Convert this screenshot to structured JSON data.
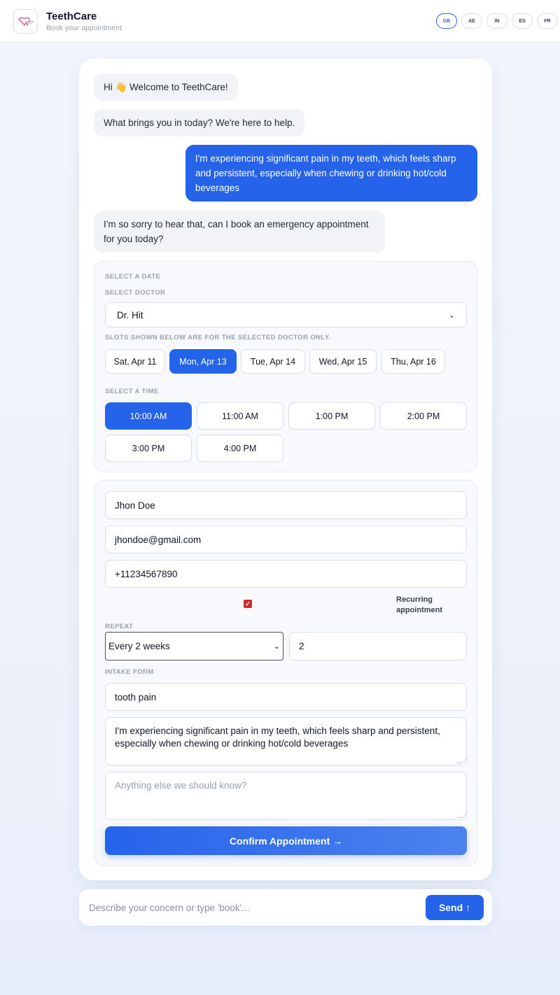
{
  "header": {
    "title": "TeethCare",
    "subtitle": "Book your appointment",
    "languages": [
      "GB",
      "AE",
      "IN",
      "ES",
      "FR"
    ],
    "active_language": "GB"
  },
  "chat": {
    "messages": [
      {
        "role": "bot",
        "text": "Hi 👋 Welcome to TeethCare!"
      },
      {
        "role": "bot",
        "text": "What brings you in today? We're here to help."
      },
      {
        "role": "user",
        "text": "I'm experiencing significant pain in my teeth, which feels sharp and persistent, especially when chewing or drinking hot/cold beverages"
      },
      {
        "role": "bot",
        "text": "I'm so sorry to hear that, can I book an emergency appointment for you today?"
      }
    ]
  },
  "scheduler": {
    "date_label": "SELECT A DATE",
    "doctor_label": "SELECT DOCTOR",
    "doctor_value": "Dr. Hit",
    "slots_note": "SLOTS SHOWN BELOW ARE FOR THE SELECTED DOCTOR ONLY.",
    "dates": [
      "Sat, Apr 11",
      "Mon, Apr 13",
      "Tue, Apr 14",
      "Wed, Apr 15",
      "Thu, Apr 16"
    ],
    "selected_date": "Mon, Apr 13",
    "time_label": "SELECT A TIME",
    "times": [
      "10:00 AM",
      "11:00 AM",
      "1:00 PM",
      "2:00 PM",
      "3:00 PM",
      "4:00 PM"
    ],
    "selected_time": "10:00 AM"
  },
  "form": {
    "name": "Jhon Doe",
    "email": "jhondoe@gmail.com",
    "phone": "+11234567890",
    "recurring_checked": true,
    "recurring_label": "Recurring appointment",
    "repeat_label": "REPEAT",
    "repeat_value": "Every 2 weeks",
    "repeat_count": "2",
    "intake_label": "INTAKE FORM",
    "intake_subject": "tooth pain",
    "intake_description": "I'm experiencing significant pain in my teeth, which feels sharp and persistent, especially when chewing or drinking hot/cold beverages",
    "notes_placeholder": "Anything else we should know?",
    "confirm_label": "Confirm Appointment →"
  },
  "composer": {
    "placeholder": "Describe your concern or type 'book'...",
    "send_label": "Send ↑"
  },
  "colors": {
    "accent": "#2563eb",
    "checkbox": "#cf2b2b"
  }
}
